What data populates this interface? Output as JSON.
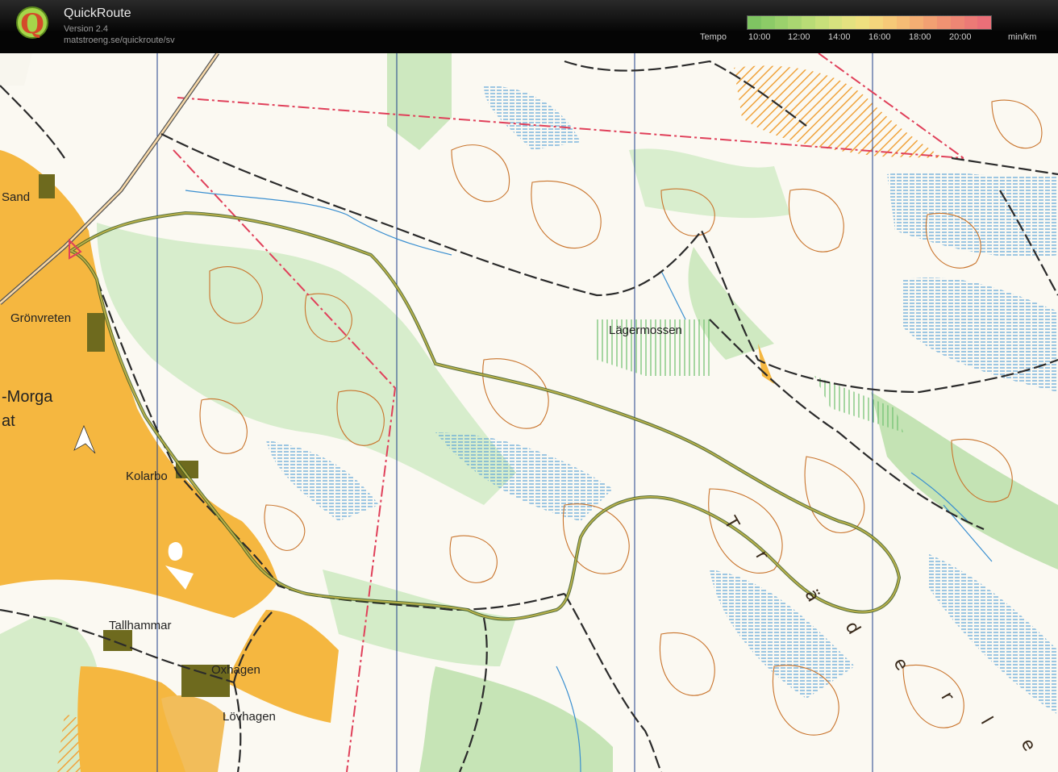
{
  "app": {
    "name": "QuickRoute",
    "version": "Version 2.4",
    "url": "matstroeng.se/quickroute/sv",
    "logo_letter": "Q"
  },
  "legend": {
    "label": "Tempo",
    "ticks": [
      "10:00",
      "12:00",
      "14:00",
      "16:00",
      "18:00",
      "20:00"
    ],
    "unit": "min/km",
    "colors": [
      "#7fc462",
      "#8ccb67",
      "#9bd16c",
      "#aad671",
      "#b9dc76",
      "#c8e07a",
      "#d7e27e",
      "#e4e280",
      "#efe07f",
      "#f4d57c",
      "#f6c978",
      "#f6bc75",
      "#f4ae73",
      "#f2a072",
      "#f09272",
      "#ee8674",
      "#ec7a76",
      "#ea6f78"
    ]
  },
  "map": {
    "place_names": [
      "Sand",
      "Grönvreten",
      "-Morga",
      "at",
      "Kolarbo",
      "Lägermossen",
      "Tallhammar",
      "Oxhagen",
      "Lövhagen"
    ],
    "ridge_letters": [
      "T",
      "r",
      "ä",
      "d",
      "e",
      "r",
      "l",
      "e"
    ],
    "colors": {
      "field": "#f5b740",
      "forest_green": "#b9dfa9",
      "marsh_blue": "#5ba3d6",
      "contour_brown": "#c9742c",
      "track": "#2b2b2b",
      "boundary": "#e0405a",
      "route": "#8a9a3a"
    }
  }
}
